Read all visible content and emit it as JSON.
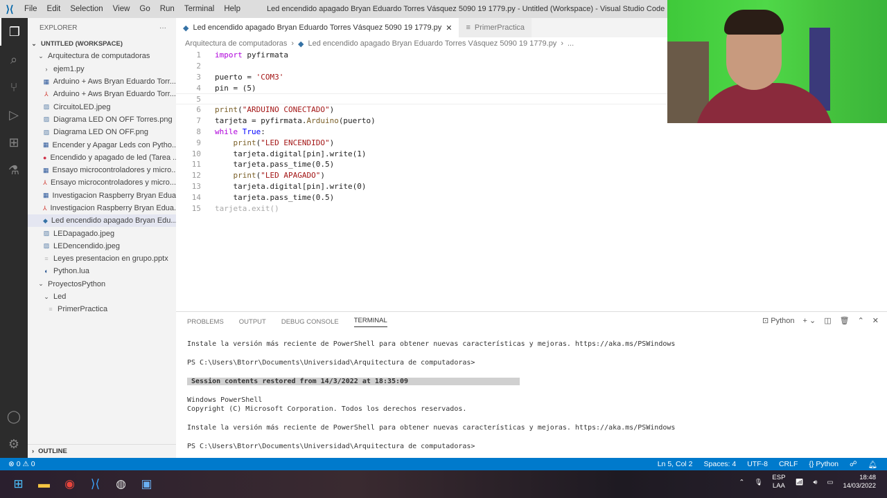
{
  "titlebar": {
    "menu": [
      "File",
      "Edit",
      "Selection",
      "View",
      "Go",
      "Run",
      "Terminal",
      "Help"
    ],
    "title": "Led encendido apagado Bryan Eduardo Torres Vásquez 5090 19 1779.py - Untitled (Workspace) - Visual Studio Code"
  },
  "sidebar": {
    "title": "EXPLORER",
    "more": "···",
    "workspace": "UNTITLED (WORKSPACE)",
    "folder": "Arquitectura de computadoras",
    "items": [
      {
        "label": "ejem1.py",
        "icon": "chevron-right"
      },
      {
        "label": "Arduino + Aws Bryan Eduardo Torr...",
        "icon": "word"
      },
      {
        "label": "Arduino + Aws Bryan Eduardo Torr...",
        "icon": "pdf"
      },
      {
        "label": "CircuitoLED.jpeg",
        "icon": "image"
      },
      {
        "label": "Diagrama LED ON OFF Torres.png",
        "icon": "image"
      },
      {
        "label": "Diagrama LED ON OFF.png",
        "icon": "image"
      },
      {
        "label": "Encender y Apagar Leds con Pytho...",
        "icon": "word"
      },
      {
        "label": "Encendido y apagado de led (Tarea ...",
        "icon": "video"
      },
      {
        "label": "Ensayo microcontroladores y micro...",
        "icon": "word"
      },
      {
        "label": "Ensayo microcontroladores y micro...",
        "icon": "pdf"
      },
      {
        "label": "Investigacion Raspberry Bryan Edua...",
        "icon": "word"
      },
      {
        "label": "Investigacion Raspberry Bryan Edua...",
        "icon": "pdf"
      },
      {
        "label": "Led encendido apagado Bryan Edu...",
        "icon": "python",
        "selected": true
      },
      {
        "label": "LEDapagado.jpeg",
        "icon": "image"
      },
      {
        "label": "LEDencendido.jpeg",
        "icon": "image"
      },
      {
        "label": "Leyes presentacion en grupo.pptx",
        "icon": "file"
      },
      {
        "label": "Python.lua",
        "icon": "lua"
      }
    ],
    "folder2": "ProyectosPython",
    "subfolder": "Led",
    "subitem": "PrimerPractica",
    "outline": "OUTLINE"
  },
  "editor": {
    "tabs": [
      "Led encendido apagado Bryan Eduardo Torres Vásquez 5090 19 1779.py",
      "PrimerPractica"
    ],
    "breadcrumb": [
      "Arquitectura de computadoras",
      "Led encendido apagado Bryan Eduardo Torres Vásquez 5090 19 1779.py",
      "..."
    ]
  },
  "code": [
    "import pyfirmata",
    "",
    "puerto = 'COM3'",
    "pin = (5)",
    "",
    "print(\"ARDUINO CONECTADO\")",
    "tarjeta = pyfirmata.Arduino(puerto)",
    "while True:",
    "    print(\"LED ENCENDIDO\")",
    "    tarjeta.digital[pin].write(1)",
    "    tarjeta.pass_time(0.5)",
    "    print(\"LED APAGADO\")",
    "    tarjeta.digital[pin].write(0)",
    "    tarjeta.pass_time(0.5)",
    "tarjeta.exit()"
  ],
  "panel": {
    "tabs": [
      "PROBLEMS",
      "OUTPUT",
      "DEBUG CONSOLE",
      "TERMINAL"
    ],
    "active_tab": "TERMINAL",
    "shell": "Python",
    "terminal": [
      "",
      "Instale la versión más reciente de PowerShell para obtener nuevas características y mejoras. https://aka.ms/PSWindows",
      "",
      "PS C:\\Users\\Btorr\\Documents\\Universidad\\Arquitectura de computadoras>",
      "",
      "Session contents restored from 14/3/2022 at 18:35:09",
      "",
      "Windows PowerShell",
      "Copyright (C) Microsoft Corporation. Todos los derechos reservados.",
      "",
      "Instale la versión más reciente de PowerShell para obtener nuevas características y mejoras. https://aka.ms/PSWindows",
      "",
      "PS C:\\Users\\Btorr\\Documents\\Universidad\\Arquitectura de computadoras>"
    ]
  },
  "status": {
    "problems": "⊗ 0 ⚠ 0",
    "position": "Ln 5, Col 2",
    "spaces": "Spaces: 4",
    "encoding": "UTF-8",
    "eol": "CRLF",
    "language": "{} Python",
    "color": "#007acc"
  },
  "taskbar": {
    "lang1": "ESP",
    "lang2": "LAA",
    "time": "18:48",
    "date": "14/03/2022"
  }
}
